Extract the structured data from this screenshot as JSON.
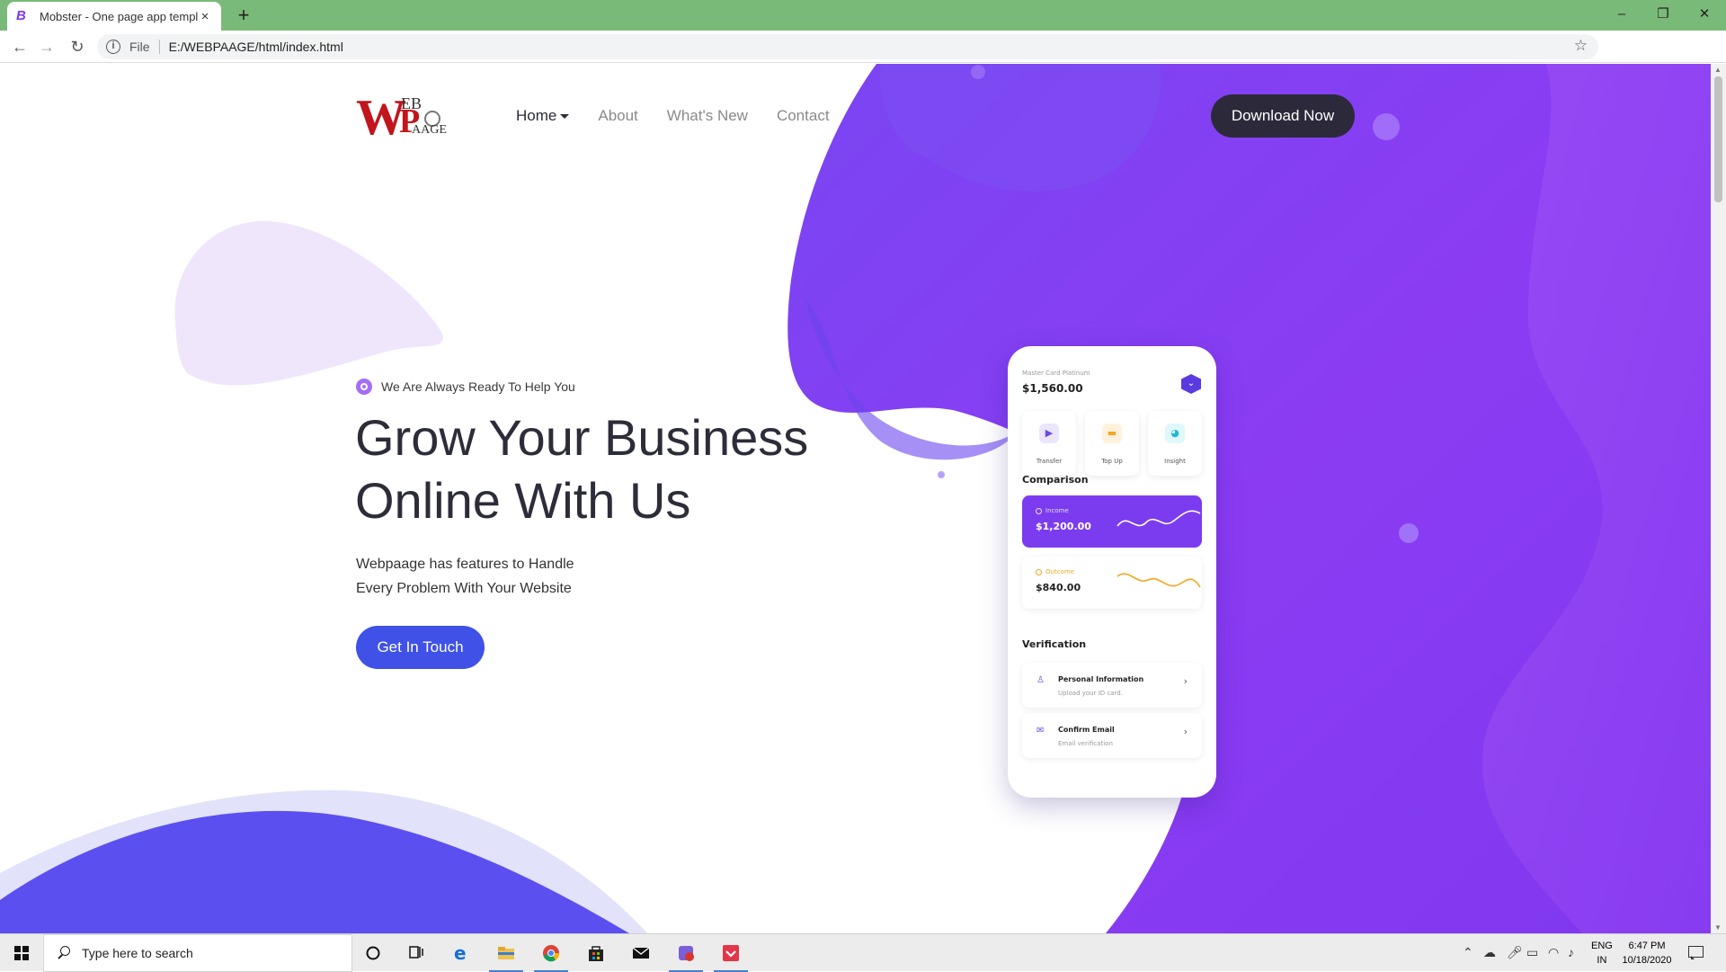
{
  "browser": {
    "tab_title": "Mobster - One page app templat",
    "tab_close": "×",
    "new_tab": "+",
    "address_scheme": "File",
    "address_url": "E:/WEBPAAGE/html/index.html",
    "window_controls": {
      "minimize": "–",
      "restore": "❐",
      "close": "✕"
    }
  },
  "site": {
    "logo": {
      "w": "W",
      "p": "P",
      "eb": "EB",
      "age": "AAGE"
    },
    "nav": [
      {
        "label": "Home",
        "active": true
      },
      {
        "label": "About",
        "active": false
      },
      {
        "label": "What's New",
        "active": false
      },
      {
        "label": "Contact",
        "active": false
      }
    ],
    "download_button": "Download Now",
    "eyebrow": "We Are Always Ready To Help You",
    "headline": [
      "Grow Your Business",
      "Online With Us"
    ],
    "subtext": [
      "Webpaage has features to Handle",
      "Every Problem With Your Website"
    ],
    "cta_button": "Get In Touch",
    "colors": {
      "purple": "#7b3cf0",
      "blue": "#3f51e6",
      "dark": "#2c2a3a"
    }
  },
  "phone": {
    "card_label": "Master Card Platinum",
    "card_balance": "$1,560.00",
    "actions": [
      {
        "label": "Transfer",
        "icon": "play-icon",
        "glyph": "▶"
      },
      {
        "label": "Top Up",
        "icon": "wallet-icon",
        "glyph": "▬"
      },
      {
        "label": "Insight",
        "icon": "pie-chart-icon",
        "glyph": "◕"
      }
    ],
    "comparison_title": "Comparison",
    "income": {
      "label": "Income",
      "value": "$1,200.00"
    },
    "outcome": {
      "label": "Outcome",
      "value": "$840.00"
    },
    "verification_title": "Verification",
    "verification": [
      {
        "title": "Personal Information",
        "subtitle": "Upload your ID card.",
        "icon": "user-icon",
        "glyph": "♙"
      },
      {
        "title": "Confirm Email",
        "subtitle": "Email verification",
        "icon": "mail-icon",
        "glyph": "✉"
      }
    ]
  },
  "taskbar": {
    "search_placeholder": "Type here to search",
    "language": [
      "ENG",
      "IN"
    ],
    "time": "6:47 PM",
    "date": "10/18/2020"
  }
}
